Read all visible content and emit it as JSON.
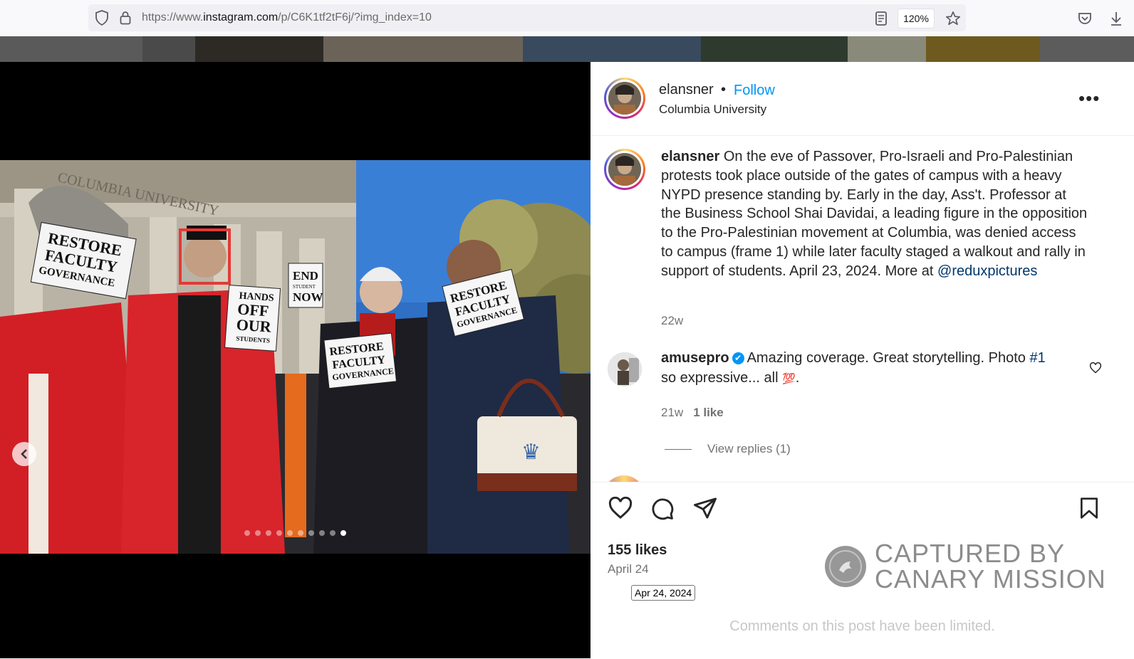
{
  "browser": {
    "url_prefix": "https://www.",
    "url_domain": "instagram.com",
    "url_path": "/p/C6K1tf2tF6j/?img_index=10",
    "zoom": "120%",
    "icons": [
      "shield-icon",
      "lock-icon",
      "reader-view-icon",
      "bookmark-star-icon",
      "pocket-icon",
      "download-icon"
    ]
  },
  "post": {
    "carousel": {
      "count": 10,
      "current": 10
    },
    "signs": {
      "sign1": [
        "RESTORE",
        "FACULTY",
        "GOVERNANCE"
      ],
      "sign2": [
        "HANDS",
        "OFF",
        "OUR",
        "STUDENTS"
      ],
      "sign3": [
        "END",
        "STUDENT",
        "NOW"
      ],
      "sign4": [
        "RESTORE",
        "FACULTY",
        "GOVERNANCE"
      ],
      "sign5": [
        "RESTORE",
        "FACULTY",
        "GOVERNANCE"
      ],
      "building": "COLUMBIA UNIVERSITY"
    }
  },
  "header": {
    "username": "elansner",
    "separator": "•",
    "follow_label": "Follow",
    "location": "Columbia University",
    "more_label": "•••"
  },
  "caption": {
    "username": "elansner",
    "text": "On the eve of Passover, Pro-Israeli and Pro-Palestinian protests took place outside of the gates of campus with a heavy NYPD presence standing by. Early in the day, Ass't. Professor at the Business School Shai Davidai, a leading figure in the opposition to the Pro-Palestinian movement at Columbia, was denied access to campus (frame 1) while later faculty staged a walkout and rally in support of students. April 23, 2024. More at",
    "mention": "@reduxpictures",
    "time": "22w"
  },
  "comment": {
    "username": "amusepro",
    "verified_mark": "✔",
    "text_before": "Amazing coverage. Great storytelling. Photo",
    "hashtag": "#1",
    "text_after": "so expressive... all",
    "emoji": "💯",
    "end": ".",
    "time": "21w",
    "likes": "1 like",
    "view_replies": "View replies (1)"
  },
  "footer": {
    "likes": "155 likes",
    "date": "April 24",
    "tooltip": "Apr 24, 2024",
    "limited": "Comments on this post have been limited."
  },
  "watermark": {
    "line1": "CAPTURED BY",
    "line2": "CANARY MISSION"
  },
  "colors": {
    "follow": "#0095f6",
    "link": "#00376b",
    "muted": "#737373"
  }
}
